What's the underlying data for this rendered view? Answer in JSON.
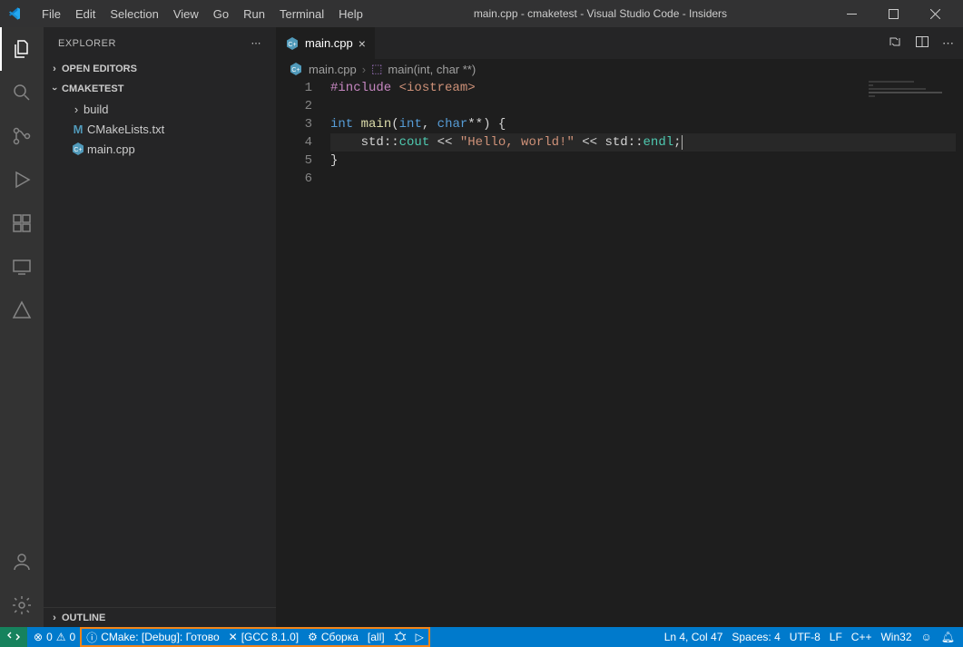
{
  "window": {
    "title": "main.cpp - cmaketest - Visual Studio Code - Insiders"
  },
  "menu": [
    "File",
    "Edit",
    "Selection",
    "View",
    "Go",
    "Run",
    "Terminal",
    "Help"
  ],
  "sidebar": {
    "title": "EXPLORER",
    "openEditors": "OPEN EDITORS",
    "project": "CMAKETEST",
    "outline": "OUTLINE",
    "tree": {
      "folder1": "build",
      "file1": "CMakeLists.txt",
      "file2": "main.cpp"
    }
  },
  "tab": {
    "name": "main.cpp"
  },
  "breadcrumb": {
    "file": "main.cpp",
    "symbol": "main(int, char **)"
  },
  "code": {
    "l1a": "#include",
    "l1b": " <iostream>",
    "l3a": "int",
    "l3b": " ",
    "l3c": "main",
    "l3d": "(",
    "l3e": "int",
    "l3f": ", ",
    "l3g": "char",
    "l3h": "**) {",
    "l4a": "    std",
    "l4b": "::",
    "l4c": "cout",
    "l4d": " << ",
    "l4e": "\"Hello, world!\"",
    "l4f": " << ",
    "l4g": "std",
    "l4h": "::",
    "l4i": "endl",
    "l4j": ";",
    "l5": "}"
  },
  "lines": [
    "1",
    "2",
    "3",
    "4",
    "5",
    "6"
  ],
  "status": {
    "errors": "0",
    "warnings": "0",
    "cmake": "CMake: [Debug]: Готово",
    "kit": "[GCC 8.1.0]",
    "build": "Сборка",
    "target": "[all]",
    "lncol": "Ln 4, Col 47",
    "spaces": "Spaces: 4",
    "encoding": "UTF-8",
    "eol": "LF",
    "lang": "C++",
    "platform": "Win32"
  }
}
